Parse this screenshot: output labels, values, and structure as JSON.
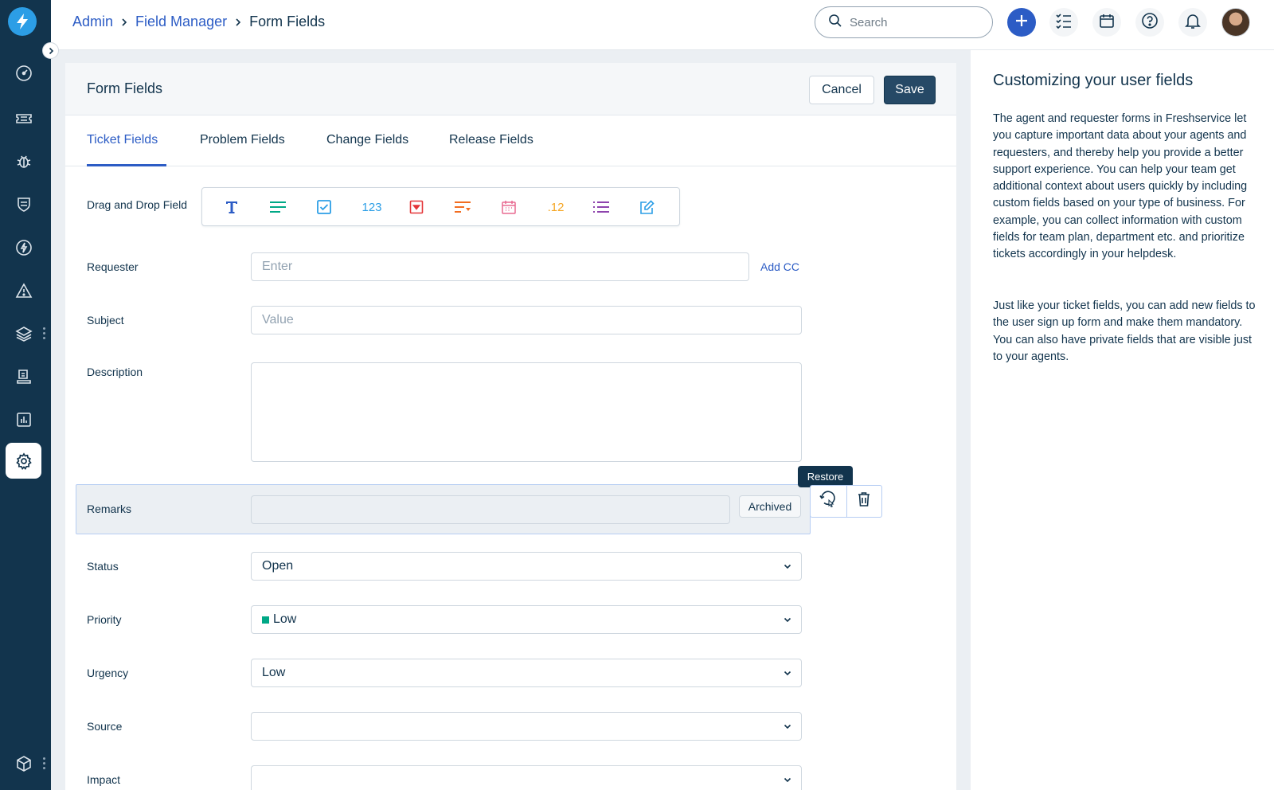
{
  "breadcrumb": {
    "admin": "Admin",
    "field_manager": "Field Manager",
    "current": "Form Fields"
  },
  "search": {
    "placeholder": "Search"
  },
  "page": {
    "title": "Form Fields",
    "cancel_label": "Cancel",
    "save_label": "Save"
  },
  "tabs": [
    "Ticket Fields",
    "Problem Fields",
    "Change Fields",
    "Release Fields"
  ],
  "palette": {
    "label": "Drag and Drop Field",
    "number_label": "123",
    "decimal_label": ".12",
    "icons": [
      "text-icon",
      "paragraph-icon",
      "checkbox-icon",
      "number-icon",
      "dropdown-icon",
      "dependent-field-icon",
      "date-icon",
      "decimal-icon",
      "list-icon",
      "edit-icon"
    ]
  },
  "fields": {
    "requester": {
      "label": "Requester",
      "placeholder": "Enter",
      "add_cc": "Add CC"
    },
    "subject": {
      "label": "Subject",
      "placeholder": "Value"
    },
    "description": {
      "label": "Description"
    },
    "remarks": {
      "label": "Remarks",
      "badge": "Archived",
      "tooltip": "Restore"
    },
    "status": {
      "label": "Status",
      "value": "Open"
    },
    "priority": {
      "label": "Priority",
      "value": "Low"
    },
    "urgency": {
      "label": "Urgency",
      "value": "Low"
    },
    "source": {
      "label": "Source",
      "value": ""
    },
    "impact": {
      "label": "Impact",
      "value": ""
    }
  },
  "help": {
    "title": "Customizing your user fields",
    "p1": "The agent and requester forms in Freshservice let you capture important data about your agents and requesters, and thereby help you provide a better support experience. You can help your team get additional context about users quickly by including custom fields based on your type of business. For example, you can collect information with custom fields for team plan, department etc. and prioritize tickets accordingly in your helpdesk.",
    "p2": "Just like your ticket fields, you can add new fields to the user sign up form and make them mandatory. You can also have private fields that are visible just to your agents."
  },
  "colors": {
    "sidebar": "#12344d",
    "accent": "#2c5cc5",
    "save": "#264966",
    "priority_low": "#00a886"
  }
}
